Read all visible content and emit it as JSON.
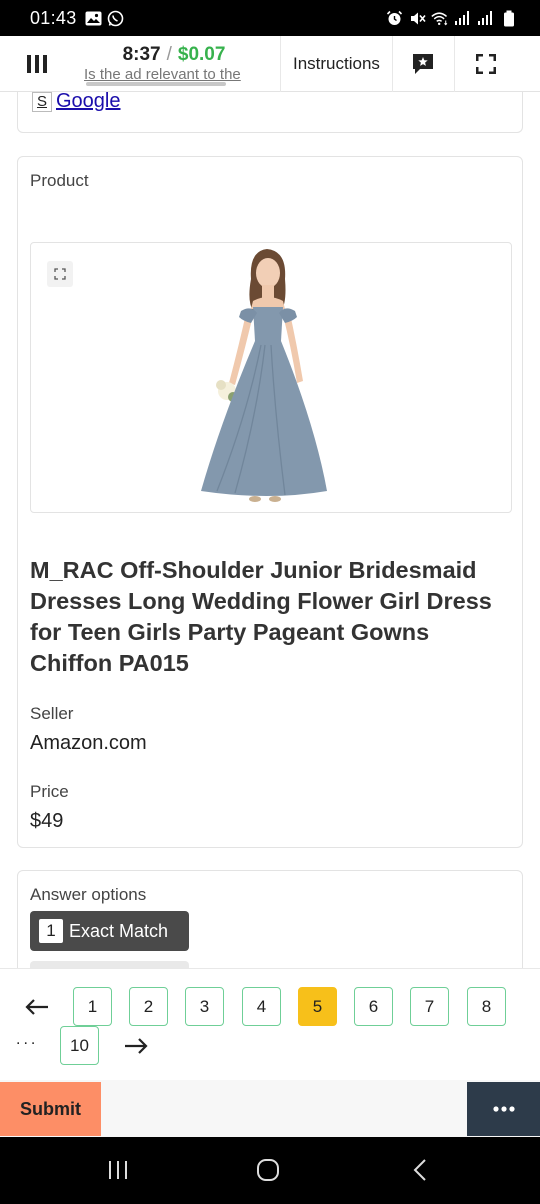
{
  "status_bar": {
    "time": "01:43",
    "left_icons": [
      "gallery-icon",
      "whatsapp-icon"
    ],
    "right_icons": [
      "alarm-icon",
      "mute-icon",
      "wifi-icon",
      "signal-icon",
      "signal-icon",
      "battery-icon"
    ]
  },
  "header": {
    "timer": "8:37",
    "slash": "/",
    "earnings": "$0.07",
    "question_text": "Is the ad relevant to the",
    "instructions_label": "Instructions",
    "menu_icon": "hamburger-icon",
    "chat_icon": "star-chat-icon",
    "fullscreen_icon": "fullscreen-icon"
  },
  "ad_source": {
    "icon_letter": "S",
    "label": "Google"
  },
  "product": {
    "section_label": "Product",
    "title": "M_RAC Off-Shoulder Junior Bridesmaid Dresses Long Wedding Flower Girl Dress for Teen Girls Party Pageant Gowns Chiffon PA015",
    "seller_label": "Seller",
    "seller_value": "Amazon.com",
    "price_label": "Price",
    "price_value": "$49"
  },
  "answers": {
    "section_label": "Answer options",
    "options": [
      {
        "hotkey": "1",
        "label": "Exact Match"
      }
    ]
  },
  "pager": {
    "pages": [
      "1",
      "2",
      "3",
      "4",
      "5",
      "6",
      "7",
      "8",
      "10"
    ],
    "current": "5",
    "dots": "..."
  },
  "actions": {
    "submit_label": "Submit"
  },
  "colors": {
    "earnings_green": "#37b24d",
    "current_page": "#f7c01a",
    "page_border": "#6fcf97",
    "submit": "#fd8e66",
    "more_button": "#2d3b4a",
    "dress": "#8398ad"
  }
}
